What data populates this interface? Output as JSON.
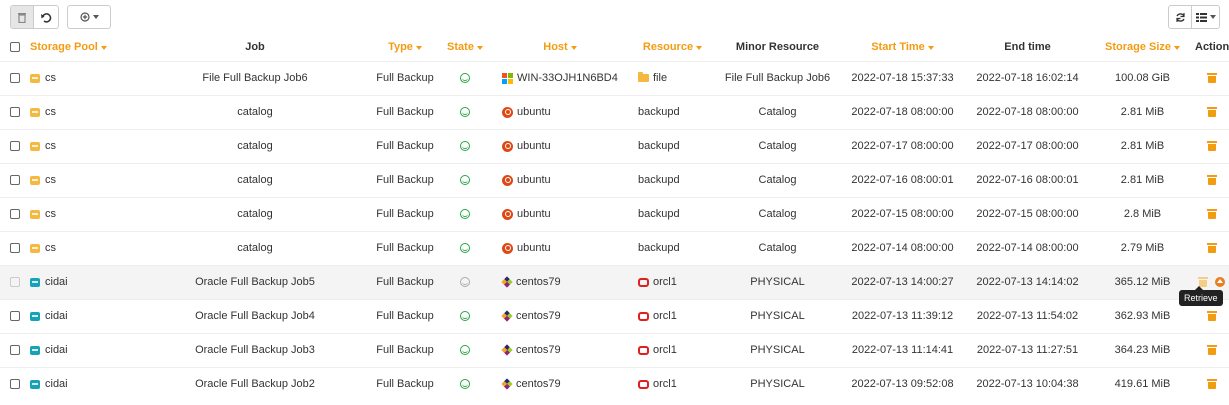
{
  "toolbar": {
    "left": [
      {
        "icon": "trash-icon"
      },
      {
        "icon": "undo-icon"
      },
      {
        "icon": "add-circle-icon"
      }
    ],
    "right": [
      {
        "icon": "refresh-icon"
      },
      {
        "icon": "columns-icon"
      }
    ]
  },
  "table": {
    "headers": {
      "storage_pool": "Storage Pool",
      "job": "Job",
      "type": "Type",
      "state": "State",
      "host": "Host",
      "resource": "Resource",
      "minor_resource": "Minor Resource",
      "start_time": "Start Time",
      "end_time": "End time",
      "storage_size": "Storage Size",
      "actions": "Actions"
    },
    "rows": [
      {
        "pool": "cs",
        "pool_color": "#f5b942",
        "job": "File Full Backup Job6",
        "type": "Full Backup",
        "state": "success",
        "host": "WIN-33OJH1N6BD4",
        "host_os": "windows",
        "resource": "file",
        "resource_kind": "folder",
        "minor": "File Full Backup Job6",
        "start": "2022-07-18 15:37:33",
        "end": "2022-07-18 16:02:14",
        "size": "100.08 GiB"
      },
      {
        "pool": "cs",
        "pool_color": "#f5b942",
        "job": "catalog",
        "type": "Full Backup",
        "state": "success",
        "host": "ubuntu",
        "host_os": "ubuntu",
        "resource": "backupd",
        "resource_kind": "none",
        "minor": "Catalog",
        "start": "2022-07-18 08:00:00",
        "end": "2022-07-18 08:00:00",
        "size": "2.81 MiB"
      },
      {
        "pool": "cs",
        "pool_color": "#f5b942",
        "job": "catalog",
        "type": "Full Backup",
        "state": "success",
        "host": "ubuntu",
        "host_os": "ubuntu",
        "resource": "backupd",
        "resource_kind": "none",
        "minor": "Catalog",
        "start": "2022-07-17 08:00:00",
        "end": "2022-07-17 08:00:00",
        "size": "2.81 MiB"
      },
      {
        "pool": "cs",
        "pool_color": "#f5b942",
        "job": "catalog",
        "type": "Full Backup",
        "state": "success",
        "host": "ubuntu",
        "host_os": "ubuntu",
        "resource": "backupd",
        "resource_kind": "none",
        "minor": "Catalog",
        "start": "2022-07-16 08:00:01",
        "end": "2022-07-16 08:00:01",
        "size": "2.81 MiB"
      },
      {
        "pool": "cs",
        "pool_color": "#f5b942",
        "job": "catalog",
        "type": "Full Backup",
        "state": "success",
        "host": "ubuntu",
        "host_os": "ubuntu",
        "resource": "backupd",
        "resource_kind": "none",
        "minor": "Catalog",
        "start": "2022-07-15 08:00:00",
        "end": "2022-07-15 08:00:00",
        "size": "2.8 MiB"
      },
      {
        "pool": "cs",
        "pool_color": "#f5b942",
        "job": "catalog",
        "type": "Full Backup",
        "state": "success",
        "host": "ubuntu",
        "host_os": "ubuntu",
        "resource": "backupd",
        "resource_kind": "none",
        "minor": "Catalog",
        "start": "2022-07-14 08:00:00",
        "end": "2022-07-14 08:00:00",
        "size": "2.79 MiB"
      },
      {
        "pool": "cidai",
        "pool_color": "#17a2b8",
        "job": "Oracle Full Backup Job5",
        "type": "Full Backup",
        "state": "neutral",
        "host": "centos79",
        "host_os": "centos",
        "resource": "orcl1",
        "resource_kind": "oracle",
        "minor": "PHYSICAL",
        "start": "2022-07-13 14:00:27",
        "end": "2022-07-13 14:14:02",
        "size": "365.12 MiB",
        "highlight": true
      },
      {
        "pool": "cidai",
        "pool_color": "#17a2b8",
        "job": "Oracle Full Backup Job4",
        "type": "Full Backup",
        "state": "success",
        "host": "centos79",
        "host_os": "centos",
        "resource": "orcl1",
        "resource_kind": "oracle",
        "minor": "PHYSICAL",
        "start": "2022-07-13 11:39:12",
        "end": "2022-07-13 11:54:02",
        "size": "362.93 MiB"
      },
      {
        "pool": "cidai",
        "pool_color": "#17a2b8",
        "job": "Oracle Full Backup Job3",
        "type": "Full Backup",
        "state": "success",
        "host": "centos79",
        "host_os": "centos",
        "resource": "orcl1",
        "resource_kind": "oracle",
        "minor": "PHYSICAL",
        "start": "2022-07-13 11:14:41",
        "end": "2022-07-13 11:27:51",
        "size": "364.23 MiB"
      },
      {
        "pool": "cidai",
        "pool_color": "#17a2b8",
        "job": "Oracle Full Backup Job2",
        "type": "Full Backup",
        "state": "success",
        "host": "centos79",
        "host_os": "centos",
        "resource": "orcl1",
        "resource_kind": "oracle",
        "minor": "PHYSICAL",
        "start": "2022-07-13 09:52:08",
        "end": "2022-07-13 10:04:38",
        "size": "419.61 MiB"
      }
    ]
  },
  "tooltip": {
    "text": "Retrieve"
  },
  "colors": {
    "accent": "#f39c12",
    "success": "#28a745",
    "oracle": "#e02020",
    "ubuntu": "#dd4814"
  }
}
